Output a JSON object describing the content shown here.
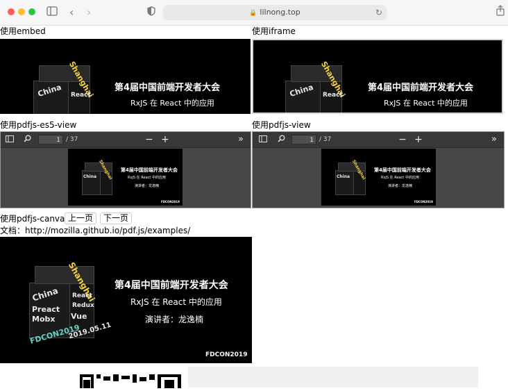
{
  "browser": {
    "url": "lilnong.top",
    "icons": [
      "close-window-icon",
      "minimize-icon",
      "zoom-icon",
      "sidebar-icon",
      "back-icon",
      "forward-icon",
      "privacy-shield-icon",
      "lock-icon",
      "reload-icon",
      "share-icon"
    ]
  },
  "sections": {
    "embed_label": "使用embed",
    "iframe_label": "使用iframe",
    "es5_label": "使用pdfjs-es5-view",
    "view_label": "使用pdfjs-view",
    "canvas_label": "使用pdfjs-canvas",
    "prev_button": "上一页",
    "next_button": "下一页",
    "docs_link": "文档：http://mozilla.github.io/pdf.js/examples/"
  },
  "slide": {
    "title": "第4届中国前端开发者大会",
    "subtitle": "RxJS 在 React 中的应用",
    "speaker": "演讲者：龙逸楠",
    "brand": "FDCON2019",
    "cube_words": [
      "Shanghai",
      "China",
      "React",
      "Redux",
      "Preact",
      "Mobx",
      "Vue",
      "FDCON2019",
      "2019.05.11"
    ]
  },
  "viewer": {
    "page_value": "1",
    "page_total": "/ 37"
  }
}
